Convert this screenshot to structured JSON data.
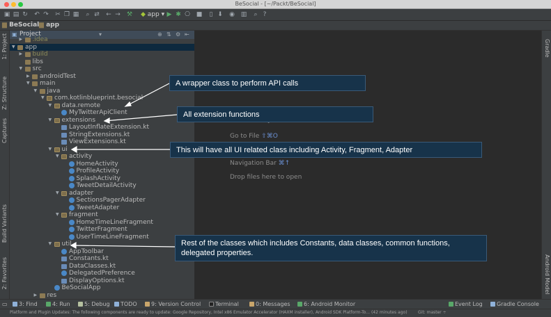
{
  "window": {
    "title": "BeSocial - [~/Packt/BeSocial]"
  },
  "toolbar": {
    "run_config": "app"
  },
  "breadcrumb": [
    "BeSocial",
    "app"
  ],
  "project_panel": {
    "title": "Project",
    "tree": [
      {
        "label": ".idea",
        "depth": 1,
        "icon": "folder",
        "expanded": false
      },
      {
        "label": "app",
        "depth": 0,
        "icon": "folder",
        "expanded": true,
        "selected": true
      },
      {
        "label": "build",
        "depth": 1,
        "icon": "folder",
        "expanded": false
      },
      {
        "label": "libs",
        "depth": 1,
        "icon": "folder",
        "expanded": null
      },
      {
        "label": "src",
        "depth": 1,
        "icon": "folder",
        "expanded": true
      },
      {
        "label": "androidTest",
        "depth": 2,
        "icon": "folder",
        "expanded": false
      },
      {
        "label": "main",
        "depth": 2,
        "icon": "folder",
        "expanded": true
      },
      {
        "label": "java",
        "depth": 3,
        "icon": "folder",
        "expanded": true
      },
      {
        "label": "com.kotlinblueprint.besocial",
        "depth": 4,
        "icon": "pkg",
        "expanded": true
      },
      {
        "label": "data.remote",
        "depth": 5,
        "icon": "pkg",
        "expanded": true
      },
      {
        "label": "MyTwitterApiClient",
        "depth": 6,
        "icon": "cls",
        "expanded": null
      },
      {
        "label": "extensions",
        "depth": 5,
        "icon": "pkg",
        "expanded": true
      },
      {
        "label": "LayoutInflateExtension.kt",
        "depth": 6,
        "icon": "kt",
        "expanded": null
      },
      {
        "label": "StringExtensions.kt",
        "depth": 6,
        "icon": "kt",
        "expanded": null
      },
      {
        "label": "ViewExtensions.kt",
        "depth": 6,
        "icon": "kt",
        "expanded": null
      },
      {
        "label": "ui",
        "depth": 5,
        "icon": "pkg",
        "expanded": true
      },
      {
        "label": "activity",
        "depth": 6,
        "icon": "pkg",
        "expanded": true
      },
      {
        "label": "HomeActivity",
        "depth": 7,
        "icon": "cls",
        "expanded": null
      },
      {
        "label": "ProfileActivity",
        "depth": 7,
        "icon": "cls",
        "expanded": null
      },
      {
        "label": "SplashActivity",
        "depth": 7,
        "icon": "cls",
        "expanded": null
      },
      {
        "label": "TweetDetailActivity",
        "depth": 7,
        "icon": "cls",
        "expanded": null
      },
      {
        "label": "adapter",
        "depth": 6,
        "icon": "pkg",
        "expanded": true
      },
      {
        "label": "SectionsPagerAdapter",
        "depth": 7,
        "icon": "cls",
        "expanded": null
      },
      {
        "label": "TweetAdapter",
        "depth": 7,
        "icon": "cls",
        "expanded": null
      },
      {
        "label": "fragment",
        "depth": 6,
        "icon": "pkg",
        "expanded": true
      },
      {
        "label": "HomeTimeLineFragment",
        "depth": 7,
        "icon": "cls",
        "expanded": null
      },
      {
        "label": "TwitterFragment",
        "depth": 7,
        "icon": "cls",
        "expanded": null
      },
      {
        "label": "UserTimeLineFragment",
        "depth": 7,
        "icon": "cls",
        "expanded": null
      },
      {
        "label": "util",
        "depth": 5,
        "icon": "pkg",
        "expanded": true
      },
      {
        "label": "AppToolbar",
        "depth": 6,
        "icon": "cls",
        "expanded": null
      },
      {
        "label": "Constants.kt",
        "depth": 6,
        "icon": "kt",
        "expanded": null
      },
      {
        "label": "DataClasses.kt",
        "depth": 6,
        "icon": "kt",
        "expanded": null
      },
      {
        "label": "DelegatedPreference",
        "depth": 6,
        "icon": "cls",
        "expanded": null
      },
      {
        "label": "DisplayOptions.kt",
        "depth": 6,
        "icon": "kt",
        "expanded": null
      },
      {
        "label": "BeSocialApp",
        "depth": 5,
        "icon": "cls",
        "expanded": null
      },
      {
        "label": "res",
        "depth": 3,
        "icon": "folder",
        "expanded": false
      }
    ]
  },
  "left_tool_tabs": [
    "1: Project",
    "Z: Structure",
    "Captures",
    "Build Variants",
    "2: Favorites"
  ],
  "right_tool_tabs": [
    "Gradle",
    "Android Model"
  ],
  "editor_hints": {
    "search": "Search Everywhere  Double ⇧",
    "goto_label": "Go to File",
    "goto_key": "⇧⌘O",
    "nav_label": "Navigation Bar",
    "nav_key": "⌘↑",
    "drop": "Drop files here to open"
  },
  "callouts": [
    {
      "text": "A wrapper class to perform API calls"
    },
    {
      "text": "All extension functions"
    },
    {
      "text": "This will have all UI related class including Activity, Fragment, Adapter"
    },
    {
      "text": "Rest of the classes which includes Constants, data classes, common functions, delegated properties."
    }
  ],
  "bottom_tabs": [
    {
      "label": "3: Find",
      "color": "#8fb1d8"
    },
    {
      "label": "4: Run",
      "color": "#59a869"
    },
    {
      "label": "5: Debug",
      "color": "#b5c1a0"
    },
    {
      "label": "TODO",
      "color": "#8fb1d8"
    },
    {
      "label": "9: Version Control",
      "color": "#c9a66b"
    },
    {
      "label": "Terminal",
      "color": "#222222"
    },
    {
      "label": "0: Messages",
      "color": "#c9a66b"
    },
    {
      "label": "6: Android Monitor",
      "color": "#59a869"
    }
  ],
  "bottom_right_tabs": [
    {
      "label": "Event Log",
      "color": "#59a869"
    },
    {
      "label": "Gradle Console",
      "color": "#8fb1d8"
    }
  ],
  "status": {
    "message": "Platform and Plugin Updates: The following components are ready to update: Google Repository, Intel x86 Emulator Accelerator (HAXM installer), Android SDK Platform-To... (42 minutes ago)",
    "git": "Git: master ÷"
  },
  "colors": {
    "accent": "#4a88c7",
    "callout_bg": "#17334a"
  }
}
